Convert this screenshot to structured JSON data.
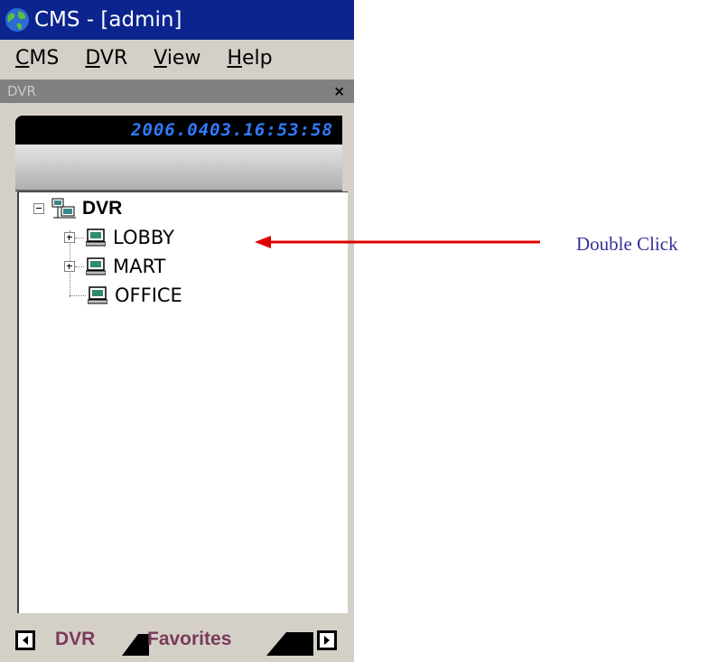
{
  "window": {
    "title": "CMS - [admin]"
  },
  "menu": {
    "items": [
      {
        "mnemonic": "C",
        "rest": "MS"
      },
      {
        "mnemonic": "D",
        "rest": "VR"
      },
      {
        "mnemonic": "V",
        "rest": "iew"
      },
      {
        "mnemonic": "H",
        "rest": "elp"
      }
    ]
  },
  "panel": {
    "title": "DVR",
    "close": "×",
    "clock": "2006.0403.16:53:58"
  },
  "tree": {
    "root": {
      "label": "DVR",
      "icon": "network-icon"
    },
    "children": [
      {
        "label": "LOBBY",
        "icon": "computer-icon",
        "expandable": true
      },
      {
        "label": "MART",
        "icon": "computer-icon",
        "expandable": true
      },
      {
        "label": "OFFICE",
        "icon": "computer-icon",
        "expandable": false
      }
    ]
  },
  "tabs": {
    "items": [
      "DVR",
      "Favorites"
    ]
  },
  "annotation": {
    "text": "Double Click",
    "color": "#333399",
    "arrow_color": "#e00000"
  },
  "colors": {
    "titlebar": "#0b248e",
    "clock_text": "#2f7bff"
  }
}
